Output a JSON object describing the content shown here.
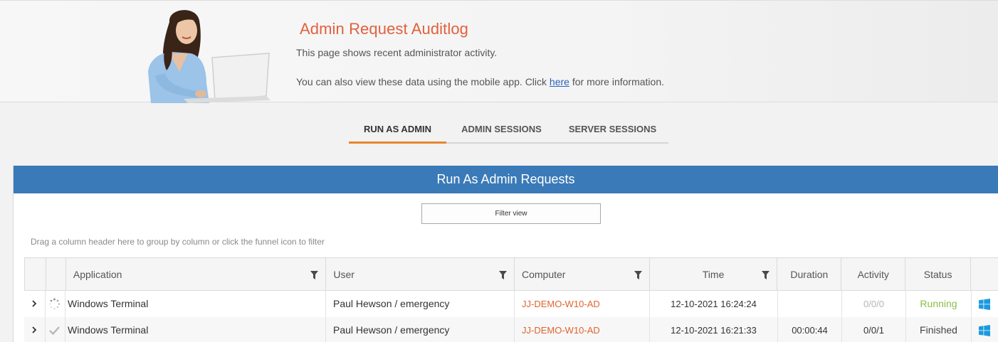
{
  "header": {
    "title": "Admin Request Auditlog",
    "description": "This page shows recent administrator activity.",
    "mobile_text_before": "You can also view these data using the mobile app. Click ",
    "mobile_link": "here",
    "mobile_text_after": " for more information."
  },
  "tabs": [
    {
      "label": "RUN AS ADMIN",
      "active": true
    },
    {
      "label": "ADMIN SESSIONS",
      "active": false
    },
    {
      "label": "SERVER SESSIONS",
      "active": false
    }
  ],
  "panel": {
    "title": "Run As Admin Requests",
    "filter_button": "Filter view",
    "group_hint": "Drag a column header here to group by column or click the funnel icon to filter"
  },
  "grid": {
    "columns": [
      "Application",
      "User",
      "Computer",
      "Time",
      "Duration",
      "Activity",
      "Status"
    ],
    "rows": [
      {
        "status_icon": "loading-spinner-icon",
        "application": "Windows Terminal",
        "user": "Paul Hewson / emergency",
        "computer": "JJ-DEMO-W10-AD",
        "time": "12-10-2021 16:24:24",
        "duration": "",
        "activity": "0/0/0",
        "status": "Running",
        "os_icon": "windows-icon"
      },
      {
        "status_icon": "checkmark-icon",
        "application": "Windows Terminal",
        "user": "Paul Hewson / emergency",
        "computer": "JJ-DEMO-W10-AD",
        "time": "12-10-2021 16:21:33",
        "duration": "00:00:44",
        "activity": "0/0/1",
        "status": "Finished",
        "os_icon": "windows-icon"
      }
    ]
  },
  "colors": {
    "title": "#e2603e",
    "panel_header": "#3a7ab8",
    "tab_active_underline": "#e8862e",
    "computer_link": "#e0642e",
    "status_running": "#8cbf47",
    "windows_icon": "#1a9ae0"
  }
}
